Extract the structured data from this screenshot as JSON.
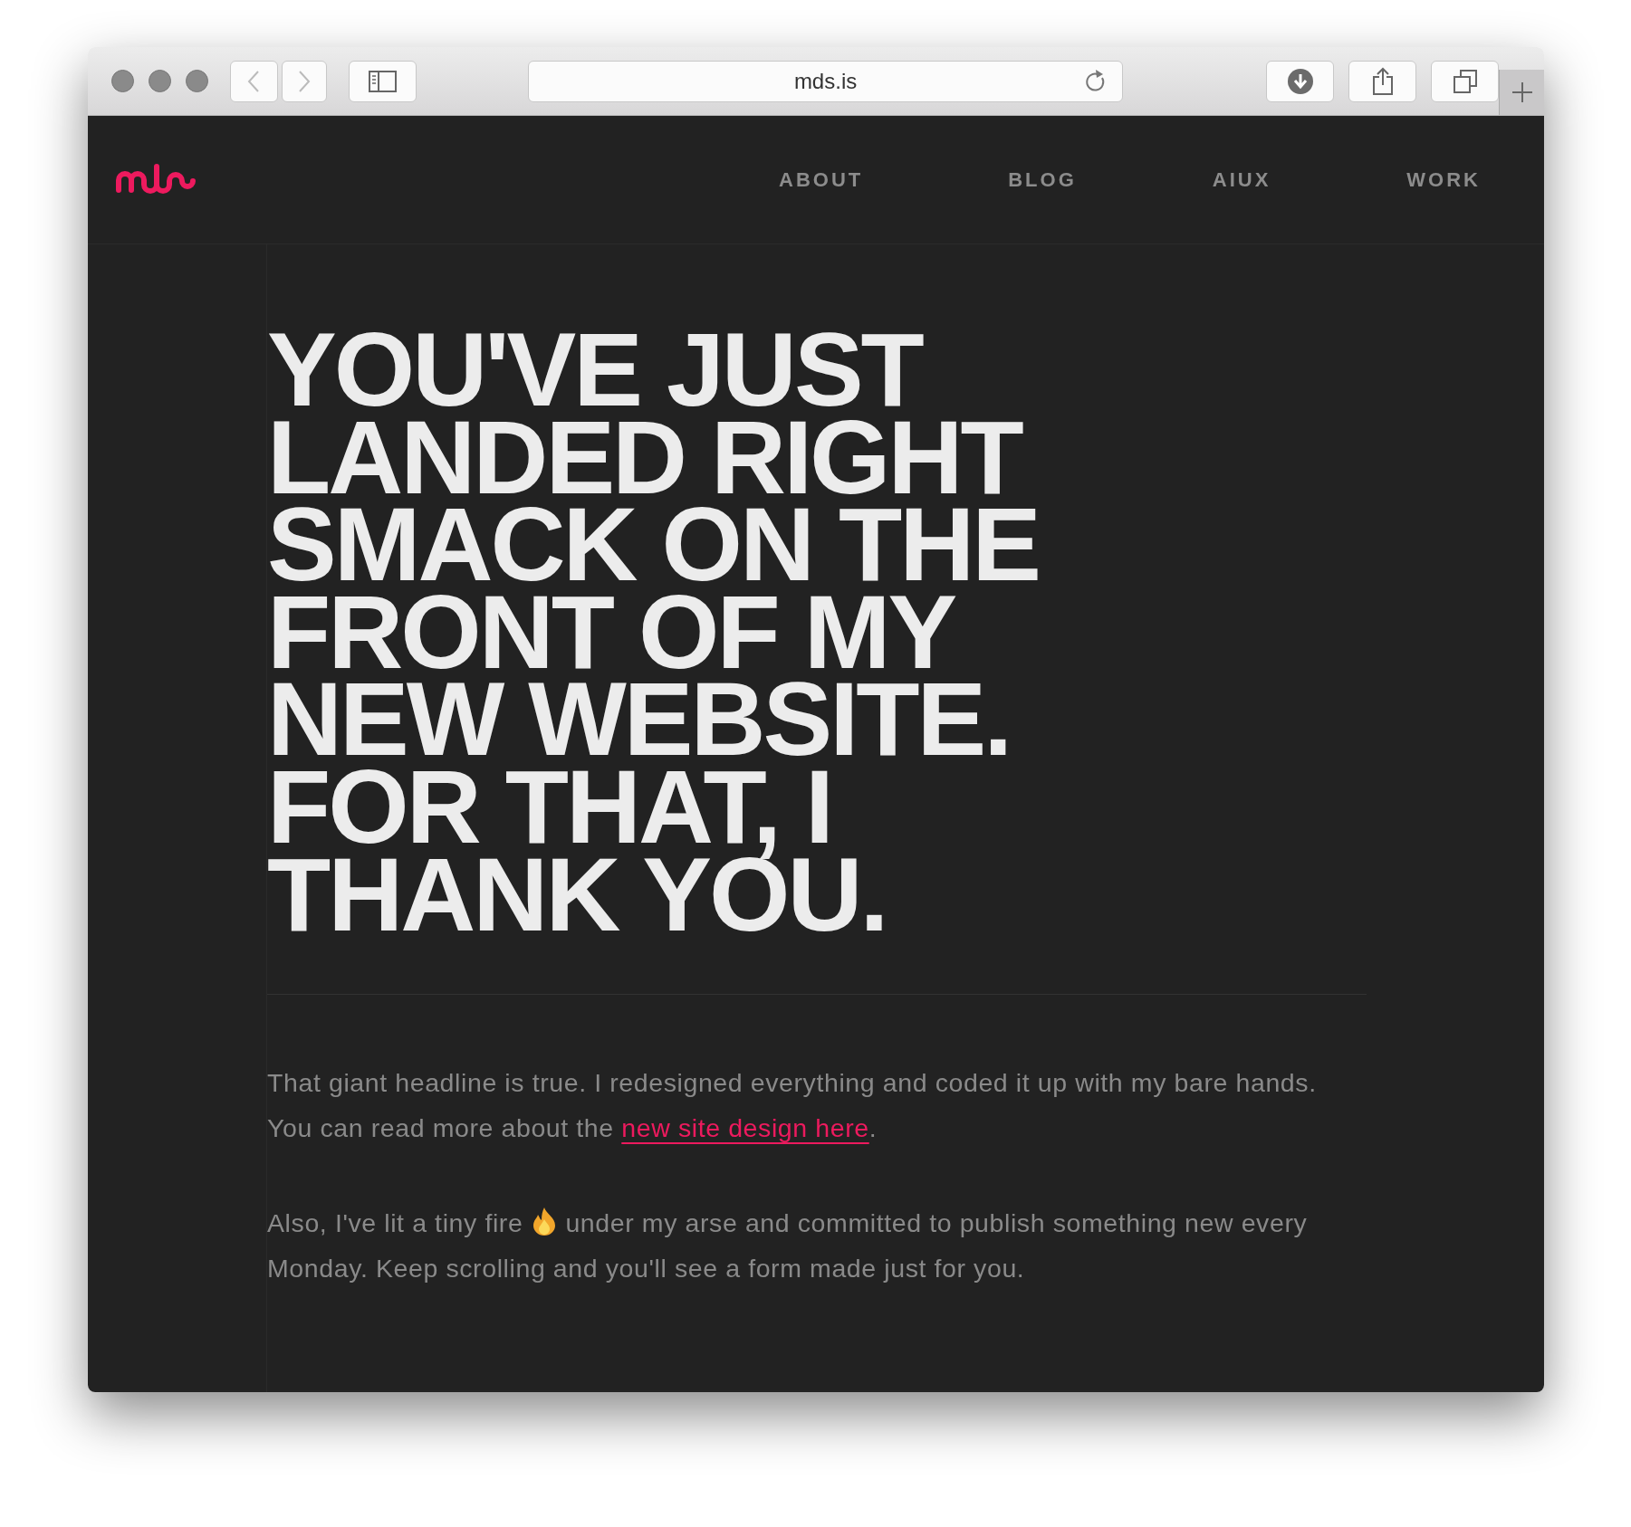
{
  "browser": {
    "address": "mds.is"
  },
  "nav": {
    "items": [
      {
        "label": "ABOUT"
      },
      {
        "label": "BLOG"
      },
      {
        "label": "AIUX"
      },
      {
        "label": "WORK"
      }
    ]
  },
  "headline": "YOU'VE JUST LANDED RIGHT SMACK ON THE FRONT OF MY NEW WEBSITE. FOR THAT, I THANK YOU.",
  "paragraphs": [
    {
      "segments": [
        {
          "kind": "text",
          "text": "That giant headline is true. I redesigned everything and coded it up with my bare hands. You can read more about the "
        },
        {
          "kind": "link",
          "text": "new site design here"
        },
        {
          "kind": "text",
          "text": "."
        }
      ]
    },
    {
      "segments": [
        {
          "kind": "text",
          "text": "Also, I've lit a tiny fire "
        },
        {
          "kind": "icon"
        },
        {
          "kind": "text",
          "text": " under my arse and committed to publish something new every Monday. Keep scrolling and you'll see a form made just for you."
        }
      ]
    }
  ]
}
